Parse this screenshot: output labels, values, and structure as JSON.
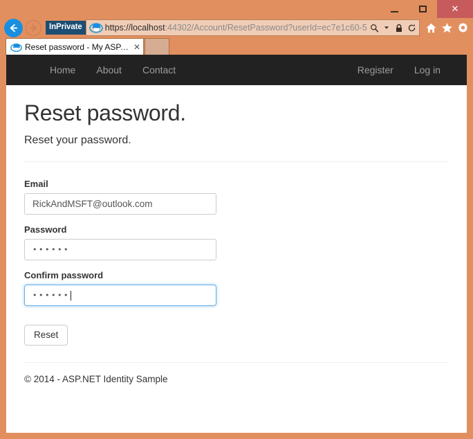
{
  "browser": {
    "window_controls": {
      "minimize": "–",
      "maximize": "□",
      "close": "✕"
    },
    "back_label": "Back",
    "forward_label": "Forward",
    "inprivate_badge": "InPrivate",
    "url_scheme": "https://",
    "url_host": "localhost",
    "url_rest": ":44302/Account/ResetPassword?userId=ec7e1c60-5",
    "url_full": "https://localhost:44302/Account/ResetPassword?userId=ec7e1c60-5",
    "address_icons": [
      "search-icon",
      "dropdown-arrow-icon",
      "lock-icon",
      "refresh-icon"
    ],
    "toolbar_icons": [
      "home-icon",
      "favorites-star-icon",
      "settings-gear-icon"
    ],
    "tab": {
      "title": "Reset password - My ASP.N...",
      "close": "✕"
    },
    "new_tab_label": ""
  },
  "site": {
    "nav_left": [
      {
        "label": "Home"
      },
      {
        "label": "About"
      },
      {
        "label": "Contact"
      }
    ],
    "nav_right": [
      {
        "label": "Register"
      },
      {
        "label": "Log in"
      }
    ]
  },
  "main": {
    "title": "Reset password.",
    "subtitle": "Reset your password.",
    "fields": [
      {
        "name": "email",
        "label": "Email",
        "value": "RickAndMSFT@outlook.com",
        "type": "text",
        "focused": false
      },
      {
        "name": "password",
        "label": "Password",
        "value": "••••••",
        "type": "password",
        "focused": false
      },
      {
        "name": "confirm-password",
        "label": "Confirm password",
        "value": "••••••",
        "type": "password",
        "focused": true
      }
    ],
    "submit_label": "Reset"
  },
  "footer": {
    "text": "© 2014 - ASP.NET Identity Sample"
  },
  "colors": {
    "frame": "#e28f5f",
    "navbar": "#222222",
    "close_button": "#c75b5b",
    "inprivate": "#1c4e73",
    "back_button": "#1a8fe0",
    "focus_border": "#66afe9"
  }
}
